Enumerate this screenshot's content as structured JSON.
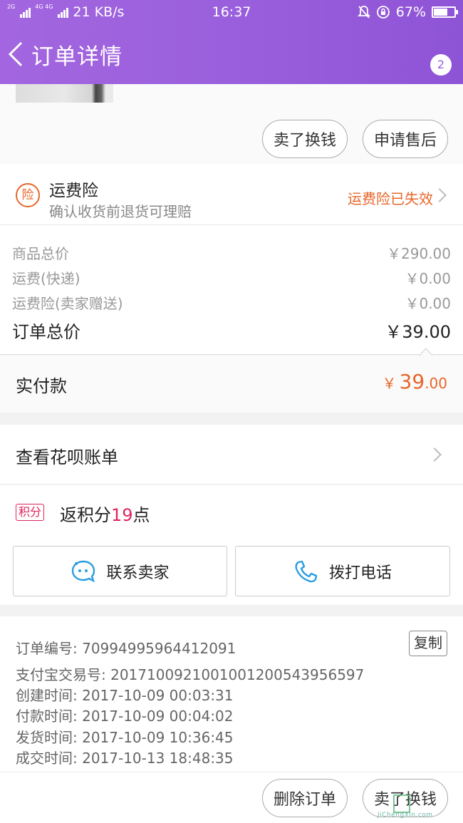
{
  "status_bar": {
    "network_tag_1": "2G",
    "network_tag_2": "4G 4G",
    "speed": "21 KB/s",
    "time": "16:37",
    "battery": "67%",
    "battery_level": 0.67
  },
  "header": {
    "title": "订单详情",
    "badge_count": "2",
    "back_icon": "chevron-left-icon",
    "more_icon": "more-vertical-icon"
  },
  "product_actions": {
    "sell_button": "卖了换钱",
    "after_sale_button": "申请售后"
  },
  "insurance": {
    "icon_text": "险",
    "title": "运费险",
    "subtitle": "确认收货前退货可理赔",
    "status": "运费险已失效"
  },
  "prices": {
    "rows": [
      {
        "label": "商品总价",
        "value": "￥290.00"
      },
      {
        "label": "运费(快递)",
        "value": "￥0.00"
      },
      {
        "label": "运费险(卖家赠送)",
        "value": "￥0.00"
      }
    ],
    "total_label": "订单总价",
    "total_value": "￥39.00"
  },
  "paid": {
    "label": "实付款",
    "symbol": "￥",
    "integer": "39",
    "decimal": ".00"
  },
  "huabei": {
    "label": "查看花呗账单"
  },
  "points": {
    "tag": "积分",
    "prefix": "返积分",
    "number": "19",
    "suffix": "点"
  },
  "contact": {
    "seller_button": "联系卖家",
    "phone_button": "拨打电话"
  },
  "order_info": {
    "copy_button": "复制",
    "order_no": "订单编号: 70994995964412091",
    "alipay_no": "支付宝交易号: 2017100921001001200543956597",
    "created": "创建时间: 2017-10-09 00:03:31",
    "paid": "付款时间: 2017-10-09 00:04:02",
    "shipped": "发货时间: 2017-10-09 10:36:45",
    "completed": "成交时间: 2017-10-13 18:48:35"
  },
  "bottom_actions": {
    "delete_button": "删除订单",
    "sell_button": "卖了换钱"
  },
  "watermark": {
    "text": "JiChengXin.com"
  },
  "colors": {
    "header": "#9a5fdc",
    "accent_orange": "#e8662a",
    "points_red": "#e0245e",
    "contact_blue": "#2a9ee0"
  }
}
